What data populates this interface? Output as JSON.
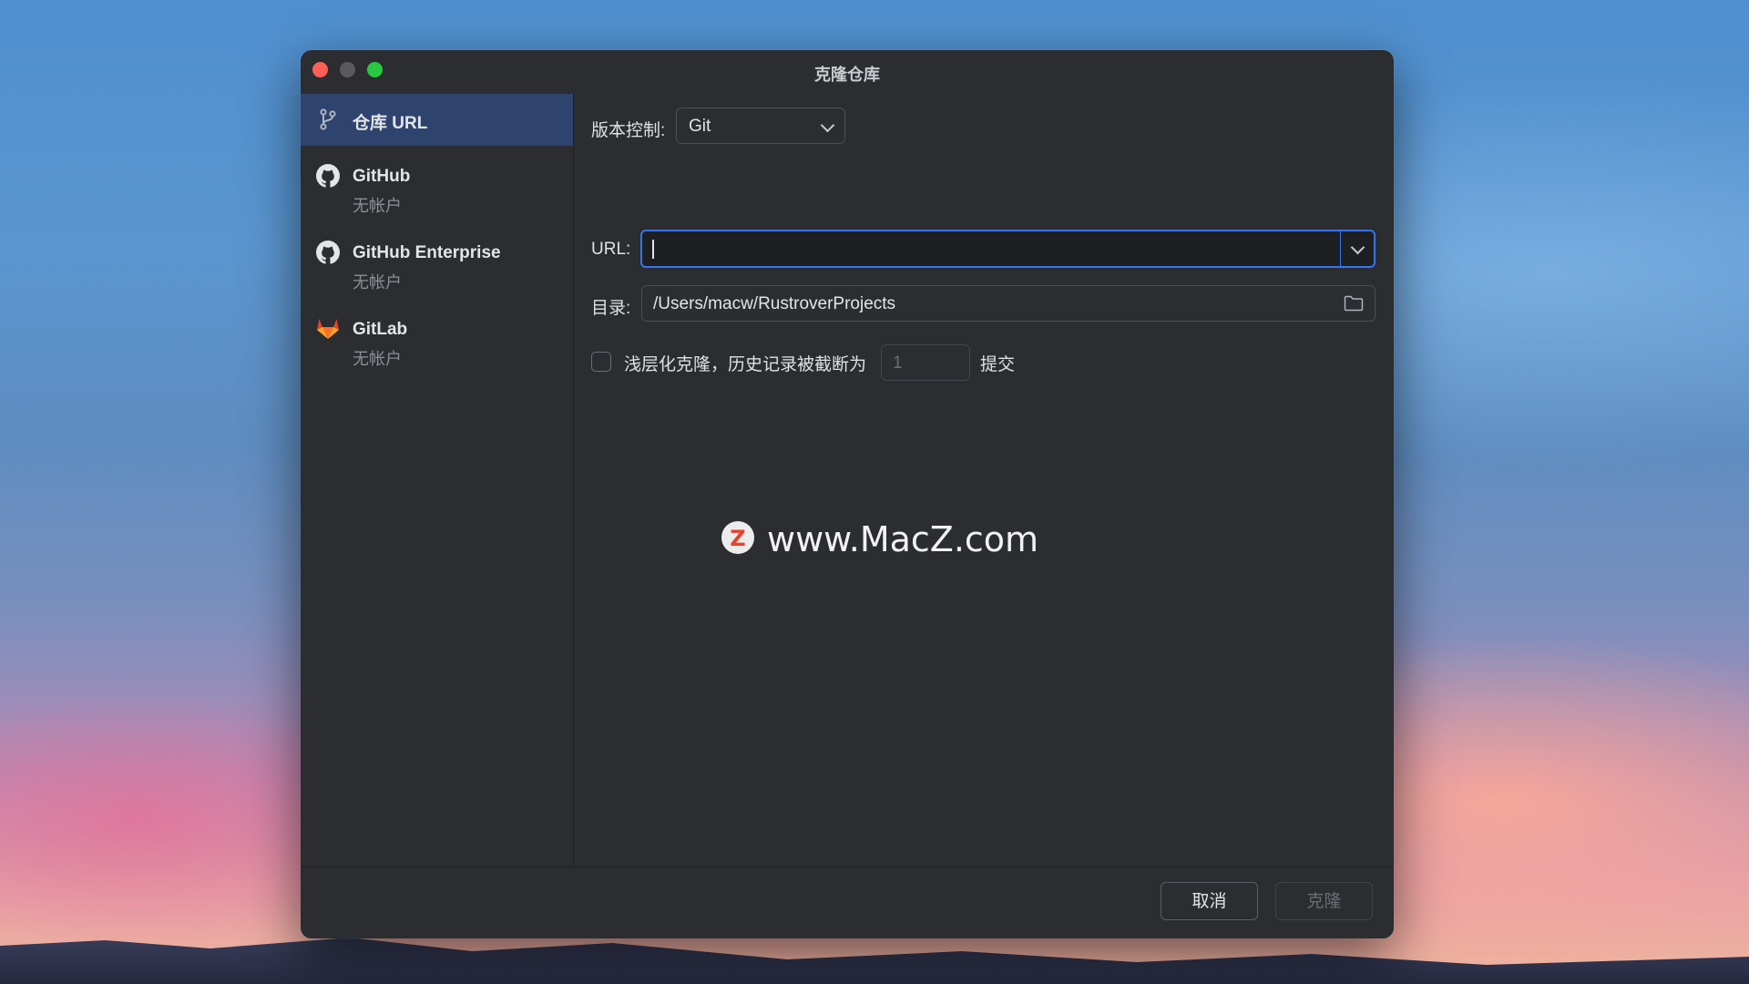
{
  "window": {
    "title": "克隆仓库"
  },
  "sidebar": {
    "items": [
      {
        "label": "仓库 URL",
        "icon": "branch-icon",
        "selected": true
      },
      {
        "label": "GitHub",
        "sublabel": "无帐户",
        "icon": "github-icon"
      },
      {
        "label": "GitHub Enterprise",
        "sublabel": "无帐户",
        "icon": "github-icon"
      },
      {
        "label": "GitLab",
        "sublabel": "无帐户",
        "icon": "gitlab-icon"
      }
    ]
  },
  "form": {
    "vcs_label": "版本控制:",
    "vcs_value": "Git",
    "url_label": "URL:",
    "url_value": "",
    "dir_label": "目录:",
    "dir_value": "/Users/macw/RustroverProjects",
    "shallow_label": "浅层化克隆，历史记录被截断为",
    "shallow_checked": false,
    "depth_value": "1",
    "commits_suffix": "提交"
  },
  "watermark": {
    "logo_letter": "Z",
    "text": "www.MacZ.com"
  },
  "footer": {
    "cancel_label": "取消",
    "clone_label": "克隆"
  },
  "colors": {
    "accent": "#3574f0",
    "selection": "#2e436e",
    "window_bg": "#2b2d31",
    "gitlab": "#e24329"
  }
}
